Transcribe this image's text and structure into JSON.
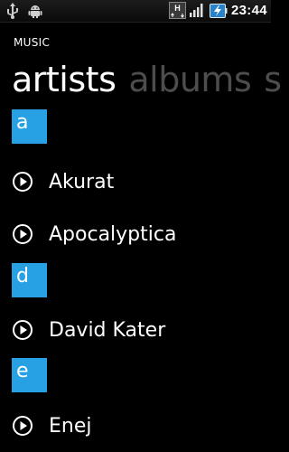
{
  "status_bar": {
    "time": "23:44",
    "icons": [
      "usb-icon",
      "android-icon",
      "h-network-icon",
      "signal-icon",
      "battery-charging-icon"
    ]
  },
  "header": {
    "app_title": "MUSIC",
    "pivot_tabs": [
      {
        "label": "artists",
        "active": true
      },
      {
        "label": "albums",
        "active": false
      },
      {
        "label": "s",
        "active": false
      }
    ]
  },
  "groups": [
    {
      "letter": "a",
      "artists": [
        "Akurat",
        "Apocalyptica"
      ]
    },
    {
      "letter": "d",
      "artists": [
        "David Kater"
      ]
    },
    {
      "letter": "e",
      "artists": [
        "Enej"
      ]
    }
  ],
  "colors": {
    "accent": "#27a1e3",
    "background": "#000000",
    "inactive_tab": "#4d4d4d"
  }
}
